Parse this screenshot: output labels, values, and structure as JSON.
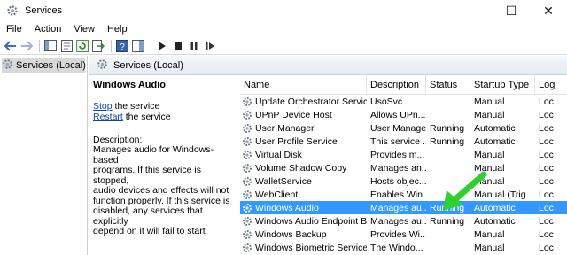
{
  "window": {
    "title": "Services",
    "minimize": "—",
    "maximize": "☐",
    "close": "✕"
  },
  "menu": [
    "File",
    "Action",
    "View",
    "Help"
  ],
  "tree": {
    "item": "Services (Local)"
  },
  "panel": {
    "header": "Services (Local)"
  },
  "description": {
    "service_name": "Windows Audio",
    "stop_link": "Stop",
    "stop_suffix": " the service",
    "restart_link": "Restart",
    "restart_suffix": " the service",
    "label": "Description:",
    "lines": [
      "Manages audio for Windows-based",
      "programs.  If this service is stopped,",
      "audio devices and effects will not",
      "function properly.  If this service is",
      "disabled, any services that explicitly",
      "depend on it will fail to start"
    ]
  },
  "grid": {
    "headers": [
      "Name",
      "Description",
      "Status",
      "Startup Type",
      "Log"
    ],
    "rows": [
      {
        "name": "Update Orchestrator Service",
        "description": "UsoSvc",
        "status": "",
        "startup": "Manual",
        "log": "Loc"
      },
      {
        "name": "UPnP Device Host",
        "description": "Allows UPn...",
        "status": "",
        "startup": "Manual",
        "log": "Loc"
      },
      {
        "name": "User Manager",
        "description": "User Manage...",
        "status": "Running",
        "startup": "Automatic",
        "log": "Loc"
      },
      {
        "name": "User Profile Service",
        "description": "This service ...",
        "status": "Running",
        "startup": "Automatic",
        "log": "Loc"
      },
      {
        "name": "Virtual Disk",
        "description": "Provides m...",
        "status": "",
        "startup": "Manual",
        "log": "Loc"
      },
      {
        "name": "Volume Shadow Copy",
        "description": "Manages an...",
        "status": "",
        "startup": "Manual",
        "log": "Loc"
      },
      {
        "name": "WalletService",
        "description": "Hosts objec...",
        "status": "",
        "startup": "Manual",
        "log": "Loc"
      },
      {
        "name": "WebClient",
        "description": "Enables Win...",
        "status": "",
        "startup": "Manual (Trig...",
        "log": "Loc"
      },
      {
        "name": "Windows Audio",
        "description": "Manages au...",
        "status": "Running",
        "startup": "Automatic",
        "log": "Loc",
        "selected": true
      },
      {
        "name": "Windows Audio Endpoint B...",
        "description": "Manages au...",
        "status": "Running",
        "startup": "Automatic",
        "log": "Loc"
      },
      {
        "name": "Windows Backup",
        "description": "Provides Wi...",
        "status": "",
        "startup": "Manual",
        "log": "Loc"
      },
      {
        "name": "Windows Biometric Service",
        "description": "The Windo...",
        "status": "",
        "startup": "Manual",
        "log": "Loc"
      }
    ]
  },
  "colors": {
    "selection": "#3399ff",
    "link": "#0b46b0",
    "arrow": "#2fd12f"
  }
}
